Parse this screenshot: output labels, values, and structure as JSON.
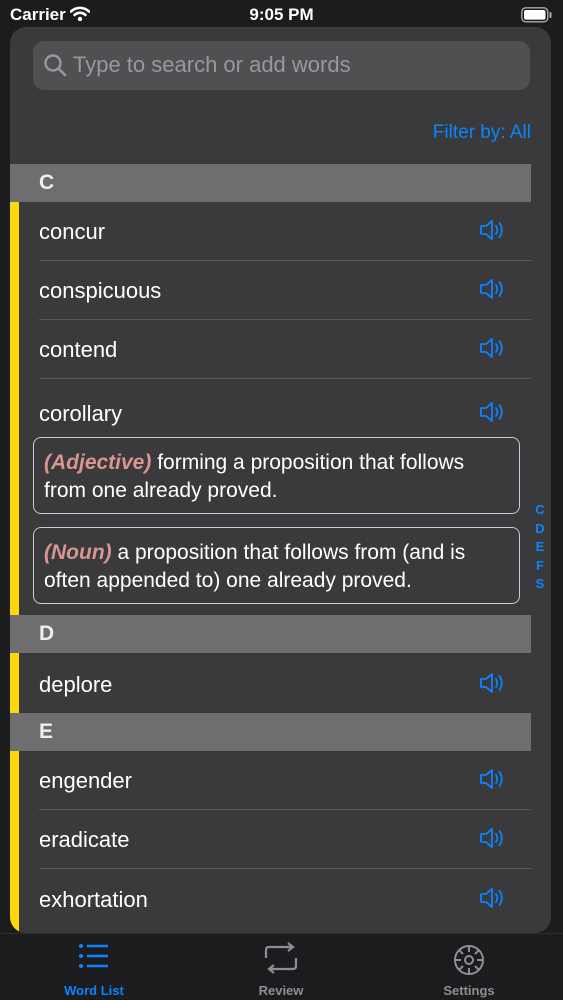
{
  "status_bar": {
    "carrier": "Carrier",
    "time": "9:05 PM"
  },
  "search": {
    "placeholder": "Type to search or add words",
    "value": ""
  },
  "filter": {
    "label": "Filter by: All"
  },
  "sections": [
    {
      "letter": "C",
      "words": [
        "concur",
        "conspicuous",
        "contend",
        "corollary"
      ]
    },
    {
      "letter": "D",
      "words": [
        "deplore"
      ]
    },
    {
      "letter": "E",
      "words": [
        "engender",
        "eradicate",
        "exhortation"
      ]
    }
  ],
  "definitions": [
    {
      "pos": "(Adjective)",
      "text": " forming a proposition that follows from one already proved."
    },
    {
      "pos": "(Noun)",
      "text": " a proposition that follows from (and is often appended to) one already proved."
    }
  ],
  "index_letters": [
    "C",
    "D",
    "E",
    "F",
    "S"
  ],
  "tabs": [
    {
      "label": "Word List",
      "icon": "list-icon",
      "active": true
    },
    {
      "label": "Review",
      "icon": "repeat-icon",
      "active": false
    },
    {
      "label": "Settings",
      "icon": "gear-icon",
      "active": false
    }
  ],
  "colors": {
    "accent": "#0a84ff",
    "highlight_bar": "#ffd60a",
    "part_of_speech": "#d9958f",
    "inactive_tab": "#8e8e93"
  }
}
